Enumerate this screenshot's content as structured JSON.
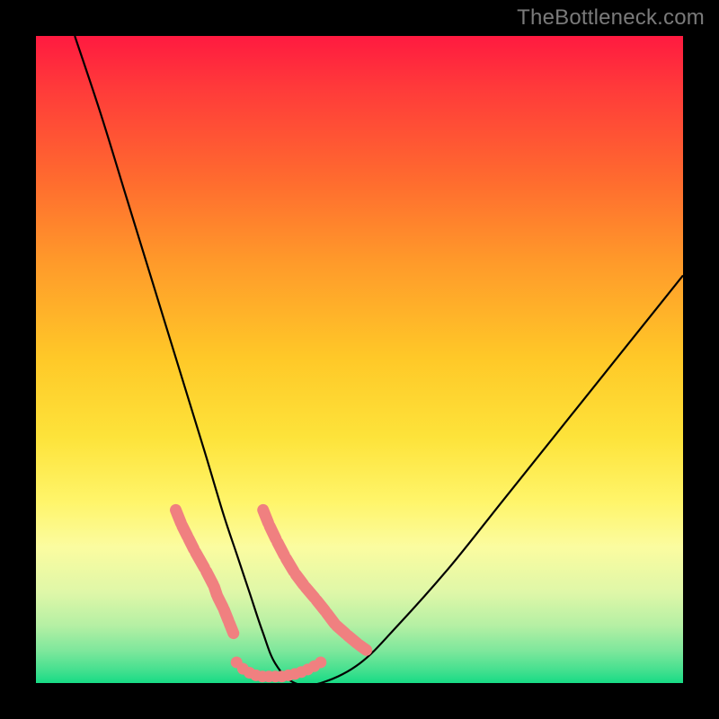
{
  "attribution": "TheBottleneck.com",
  "chart_data": {
    "type": "line",
    "title": "",
    "xlabel": "",
    "ylabel": "",
    "xlim": [
      0,
      100
    ],
    "ylim": [
      0,
      100
    ],
    "grid": false,
    "legend": false,
    "series": [
      {
        "name": "bottleneck-curve",
        "color": "#000000",
        "x": [
          6,
          10,
          14,
          18,
          22,
          26,
          29,
          31,
          33,
          35,
          37,
          40,
          44,
          50,
          56,
          64,
          72,
          80,
          88,
          96,
          100
        ],
        "y": [
          100,
          88,
          75,
          62,
          49,
          36,
          26,
          20,
          14,
          8,
          3,
          0,
          0,
          3,
          9,
          18,
          28,
          38,
          48,
          58,
          63
        ]
      },
      {
        "name": "left-highlight-segments",
        "color": "#f08080",
        "x": [
          21.5,
          22.5,
          23.5,
          24.5,
          26.2,
          27.5,
          28.0,
          29.0,
          29.8,
          30.6
        ],
        "y": [
          27,
          24.5,
          22.5,
          20.5,
          17.5,
          15,
          13.5,
          11.5,
          9.5,
          7.5
        ]
      },
      {
        "name": "right-highlight-segments",
        "color": "#f08080",
        "x": [
          35.0,
          36.0,
          37.2,
          38.5,
          40.0,
          41.5,
          43.2,
          44.8,
          46.3,
          48.0,
          49.8,
          51.2
        ],
        "y": [
          27,
          24.5,
          22,
          19.5,
          17,
          15,
          13,
          11,
          9,
          7.5,
          6,
          5
        ]
      },
      {
        "name": "bottom-valley-dots",
        "color": "#f08080",
        "x": [
          31.0,
          32.0,
          33.0,
          34.0,
          35.0,
          36.0,
          37.0,
          38.0,
          39.0,
          40.0,
          41.0,
          42.0,
          43.0,
          44.0
        ],
        "y": [
          3.2,
          2.2,
          1.6,
          1.2,
          1.0,
          1.0,
          1.0,
          1.0,
          1.2,
          1.4,
          1.7,
          2.1,
          2.6,
          3.2
        ]
      }
    ],
    "gradient": {
      "direction": "top-to-bottom",
      "stops": [
        {
          "pos": 0.0,
          "color": "#ff1a40"
        },
        {
          "pos": 0.08,
          "color": "#ff3a3a"
        },
        {
          "pos": 0.22,
          "color": "#ff6a2f"
        },
        {
          "pos": 0.35,
          "color": "#ff9a2a"
        },
        {
          "pos": 0.5,
          "color": "#ffc928"
        },
        {
          "pos": 0.62,
          "color": "#fde33a"
        },
        {
          "pos": 0.72,
          "color": "#fff56a"
        },
        {
          "pos": 0.79,
          "color": "#fbfca0"
        },
        {
          "pos": 0.86,
          "color": "#dff7a8"
        },
        {
          "pos": 0.91,
          "color": "#b6f0a4"
        },
        {
          "pos": 0.95,
          "color": "#7ee79c"
        },
        {
          "pos": 0.98,
          "color": "#45e08f"
        },
        {
          "pos": 1.0,
          "color": "#17db85"
        }
      ]
    }
  }
}
